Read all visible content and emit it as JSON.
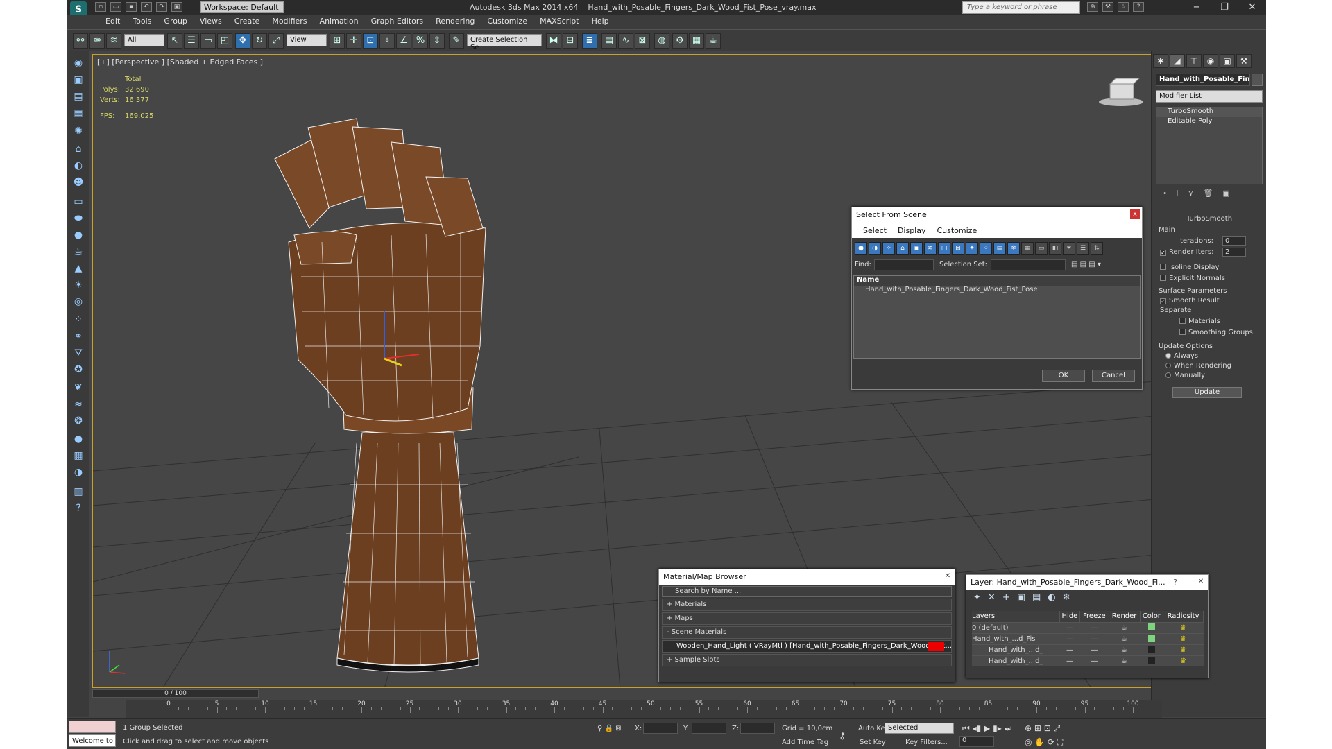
{
  "title": {
    "app": "Autodesk 3ds Max  2014 x64",
    "file": "Hand_with_Posable_Fingers_Dark_Wood_Fist_Pose_vray.max",
    "workspace": "Workspace: Default",
    "search_placeholder": "Type a keyword or phrase"
  },
  "menu": [
    "Edit",
    "Tools",
    "Group",
    "Views",
    "Create",
    "Modifiers",
    "Animation",
    "Graph Editors",
    "Rendering",
    "Customize",
    "MAXScript",
    "Help"
  ],
  "toolbar": {
    "selection_filter": "All",
    "ref_coord": "View",
    "named_selection": "Create Selection Se"
  },
  "viewport": {
    "label": "[+] [Perspective ] [Shaded + Edged Faces ]",
    "stats": {
      "total": "Total",
      "polys_label": "Polys:",
      "polys": "32 690",
      "verts_label": "Verts:",
      "verts": "16 377",
      "fps_label": "FPS:",
      "fps": "169,025"
    }
  },
  "command_panel": {
    "object_name": "Hand_with_Posable_Fing",
    "modifier_list": "Modifier List",
    "stack": [
      "TurboSmooth",
      "Editable Poly"
    ],
    "rollout": "TurboSmooth",
    "main": "Main",
    "iterations_label": "Iterations:",
    "iterations": "0",
    "render_iters_label": "Render Iters:",
    "render_iters": "2",
    "isoline": "Isoline Display",
    "explicit_normals": "Explicit Normals",
    "surface_params": "Surface Parameters",
    "smooth_result": "Smooth Result",
    "separate": "Separate",
    "materials": "Materials",
    "smoothing_groups": "Smoothing Groups",
    "update_options": "Update Options",
    "always": "Always",
    "when_rendering": "When Rendering",
    "manually": "Manually",
    "update": "Update"
  },
  "select_from_scene": {
    "title": "Select From Scene",
    "menu": [
      "Select",
      "Display",
      "Customize"
    ],
    "find_label": "Find:",
    "selection_set_label": "Selection Set:",
    "col_name": "Name",
    "item": "Hand_with_Posable_Fingers_Dark_Wood_Fist_Pose",
    "ok": "OK",
    "cancel": "Cancel"
  },
  "material_browser": {
    "title": "Material/Map Browser",
    "search": "Search by Name ...",
    "sections": [
      "+ Materials",
      "+ Maps",
      "- Scene Materials"
    ],
    "material": "Wooden_Hand_Light ( VRayMtl ) [Hand_with_Posable_Fingers_Dark_Wood_Fist...",
    "sample_slots": "+ Sample Slots"
  },
  "layer_dialog": {
    "title": "Layer: Hand_with_Posable_Fingers_Dark_Wood_Fi...",
    "help": "?",
    "columns": [
      "Layers",
      "Hide",
      "Freeze",
      "Render",
      "Color",
      "Radiosity"
    ],
    "rows": [
      {
        "name": "0 (default)",
        "color": "#7ed37e"
      },
      {
        "name": "Hand_with_...d_Fis",
        "color": "#7ed37e"
      },
      {
        "name": "Hand_with_...d_",
        "color": "#222222"
      },
      {
        "name": "Hand_with_...d_",
        "color": "#222222"
      }
    ]
  },
  "timeline": {
    "frame": "0 / 100",
    "ticks": [
      "0",
      "5",
      "10",
      "15",
      "20",
      "25",
      "30",
      "35",
      "40",
      "45",
      "50",
      "55",
      "60",
      "65",
      "70",
      "75",
      "80",
      "85",
      "90",
      "95",
      "100"
    ]
  },
  "status": {
    "maxscript": "Welcome to M",
    "selected": "1 Group Selected",
    "prompt": "Click and drag to select and move objects",
    "x_label": "X:",
    "y_label": "Y:",
    "z_label": "Z:",
    "grid": "Grid = 10,0cm",
    "add_time_tag": "Add Time Tag",
    "auto_key": "Auto Key",
    "set_key": "Set Key",
    "key_mode": "Selected",
    "key_filters": "Key Filters...",
    "frame_field": "0"
  },
  "colors": {
    "accent": "#2f6fae",
    "viewport_border": "#c9a227",
    "wood": "#6b3f1f"
  }
}
